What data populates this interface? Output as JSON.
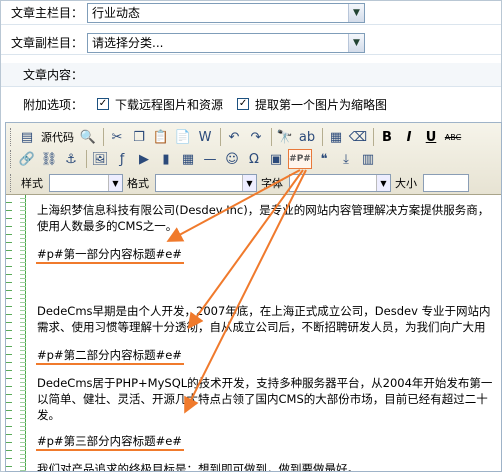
{
  "form": {
    "main_column_label": "文章主栏目：",
    "main_column_value": "行业动态",
    "sub_column_label": "文章副栏目：",
    "sub_column_value": "请选择分类...",
    "content_label": "文章内容：",
    "options_label": "附加选项：",
    "option_download_images": "下载远程图片和资源",
    "option_first_image_thumb": "提取第一个图片为缩略图"
  },
  "toolbar": {
    "source_code": "源代码",
    "style_label": "样式",
    "format_label": "格式",
    "font_label": "字体",
    "size_label": "大小",
    "pagebreak_icon_text": "#P#",
    "bold": "B",
    "italic": "I",
    "underline": "U",
    "strike": "ABC"
  },
  "content": {
    "p1_line1": "上海织梦信息科技有限公司(Desdev Inc)，是专业的网站内容管理解决方案提供服务商，",
    "p1_line2": "使用人数最多的CMS之一。",
    "marker1": "#p#第一部分内容标题#e#",
    "p2_line1": "DedeCms早期是由个人开发，2007年底，在上海正式成立公司，Desdev 专业于网站内",
    "p2_line2": "需求、使用习惯等理解十分透彻，自从成立公司后，不断招聘研发人员，为我们向广大用",
    "marker2": "#p#第二部分内容标题#e#",
    "p3_line1": "DedeCms居于PHP+MySQL的技术开发，支持多种服务器平台，从2004年开始发布第一",
    "p3_line2": "以简单、健壮、灵活、开源几大特点占领了国内CMS的大部份市场，目前已经有超过二十",
    "p3_line3": "发。",
    "marker3": "#p#第三部分内容标题#e#",
    "p4_line1": "我们对产品追求的终极目标是：想到即可做到，做到要做最好。"
  },
  "colors": {
    "annotation": "#f07a2c",
    "ruler": "#4aa84a"
  }
}
